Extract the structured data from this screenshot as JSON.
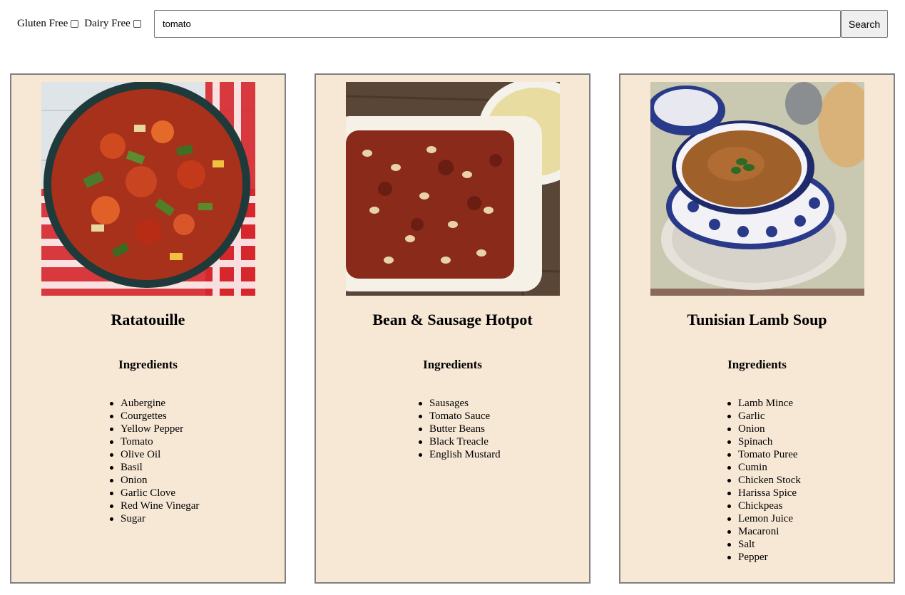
{
  "filters": {
    "gluten_free_label": "Gluten Free",
    "dairy_free_label": "Dairy Free"
  },
  "search": {
    "value": "tomato",
    "button_label": "Search"
  },
  "recipes": [
    {
      "title": "Ratatouille",
      "ingredients_heading": "Ingredients",
      "ingredients": [
        "Aubergine",
        "Courgettes",
        "Yellow Pepper",
        "Tomato",
        "Olive Oil",
        "Basil",
        "Onion",
        "Garlic Clove",
        "Red Wine Vinegar",
        "Sugar"
      ]
    },
    {
      "title": "Bean & Sausage Hotpot",
      "ingredients_heading": "Ingredients",
      "ingredients": [
        "Sausages",
        "Tomato Sauce",
        "Butter Beans",
        "Black Treacle",
        "English Mustard"
      ]
    },
    {
      "title": "Tunisian Lamb Soup",
      "ingredients_heading": "Ingredients",
      "ingredients": [
        "Lamb Mince",
        "Garlic",
        "Onion",
        "Spinach",
        "Tomato Puree",
        "Cumin",
        "Chicken Stock",
        "Harissa Spice",
        "Chickpeas",
        "Lemon Juice",
        "Macaroni",
        "Salt",
        "Pepper"
      ]
    }
  ],
  "colors": {
    "card_background": "#f7e8d6",
    "card_border": "#808080"
  }
}
